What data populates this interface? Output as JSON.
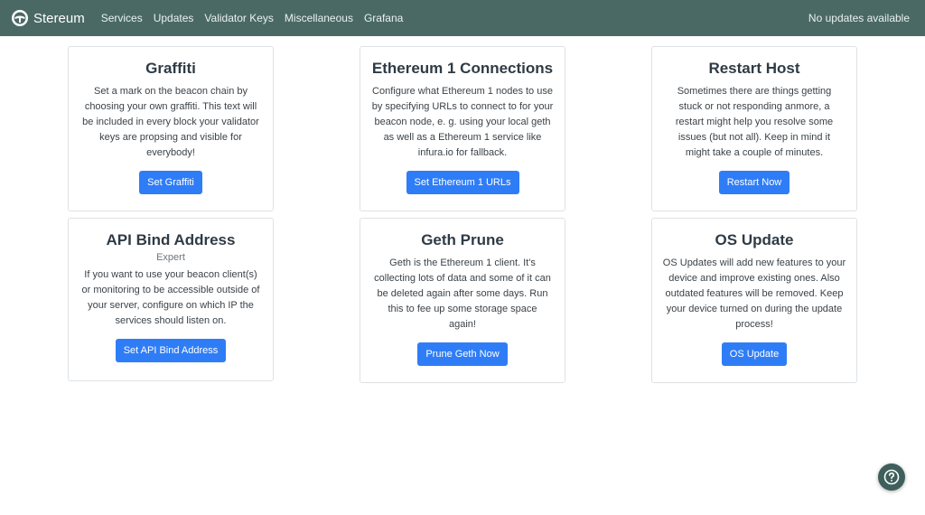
{
  "navbar": {
    "brand": "Stereum",
    "links": [
      "Services",
      "Updates",
      "Validator Keys",
      "Miscellaneous",
      "Grafana"
    ],
    "status": "No updates available",
    "background": "#4a6965"
  },
  "cards": [
    {
      "title": "Graffiti",
      "text": "Set a mark on the beacon chain by choosing your own graffiti. This text will be included in every block your validator keys are propsing and visible for everybody!",
      "button": "Set Graffiti"
    },
    {
      "title": "Ethereum 1 Connections",
      "text": "Configure what Ethereum 1 nodes to use by specifying URLs to connect to for your beacon node, e. g. using your local geth as well as a Ethereum 1 service like infura.io for fallback.",
      "button": "Set Ethereum 1 URLs"
    },
    {
      "title": "Restart Host",
      "text": "Sometimes there are things getting stuck or not responding anmore, a restart might help you resolve some issues (but not all). Keep in mind it might take a couple of minutes.",
      "button": "Restart Now"
    },
    {
      "title": "API Bind Address",
      "subtitle": "Expert",
      "text": "If you want to use your beacon client(s) or monitoring to be accessible outside of your server, configure on which IP the services should listen on.",
      "button": "Set API Bind Address"
    },
    {
      "title": "Geth Prune",
      "text": "Geth is the Ethereum 1 client. It's collecting lots of data and some of it can be deleted again after some days. Run this to fee up some storage space again!",
      "button": "Prune Geth Now"
    },
    {
      "title": "OS Update",
      "text": "OS Updates will add new features to your device and improve existing ones. Also outdated features will be removed. Keep your device turned on during the update process!",
      "button": "OS Update"
    }
  ],
  "colors": {
    "primary": "#2f7df6",
    "help_button": "#3e5f5b"
  },
  "help": {
    "icon": "question-icon"
  }
}
